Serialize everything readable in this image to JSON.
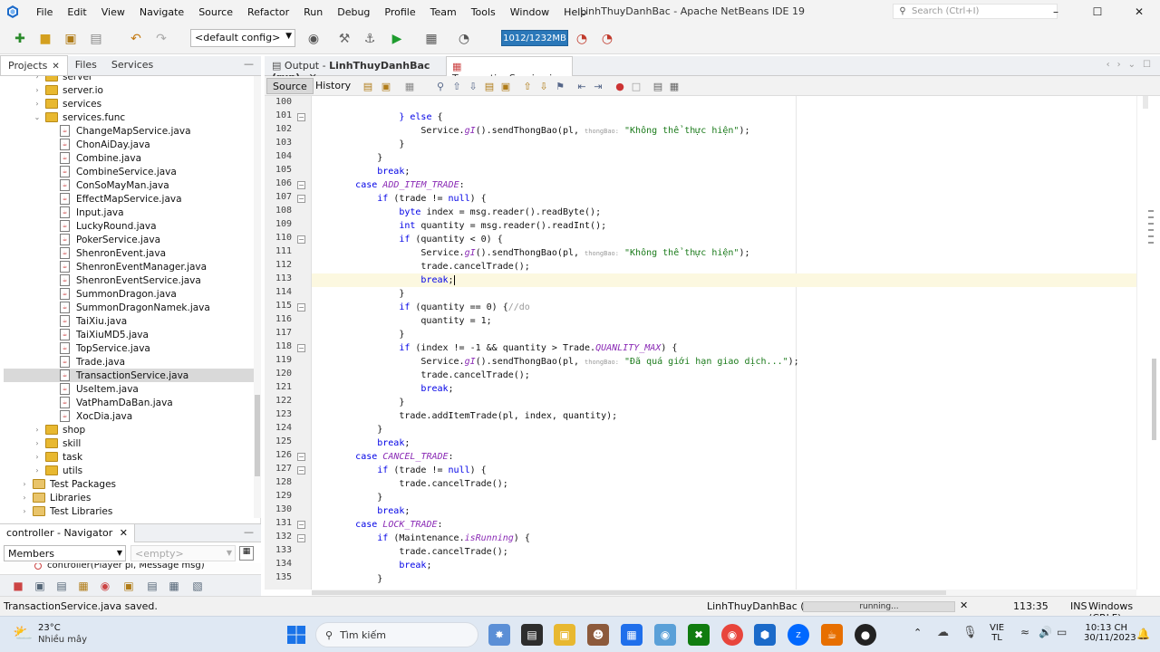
{
  "window": {
    "title": "LinhThuyDanhBac - Apache NetBeans IDE 19",
    "search_placeholder": "Search (Ctrl+I)",
    "minimize": "–",
    "maximize": "☐",
    "close": "✕"
  },
  "menu": [
    "File",
    "Edit",
    "View",
    "Navigate",
    "Source",
    "Refactor",
    "Run",
    "Debug",
    "Profile",
    "Team",
    "Tools",
    "Window",
    "Help"
  ],
  "toolbar": {
    "config": "<default config>",
    "memory": "1012/1232MB"
  },
  "left_tabs": [
    "Projects",
    "Files",
    "Services"
  ],
  "tree": [
    {
      "label": "server",
      "type": "folder"
    },
    {
      "label": "server.io",
      "type": "folder"
    },
    {
      "label": "services",
      "type": "folder"
    },
    {
      "label": "services.func",
      "type": "folder",
      "open": true
    },
    {
      "label": "ChangeMapService.java",
      "type": "file"
    },
    {
      "label": "ChonAiDay.java",
      "type": "file"
    },
    {
      "label": "Combine.java",
      "type": "file"
    },
    {
      "label": "CombineService.java",
      "type": "file"
    },
    {
      "label": "ConSoMayMan.java",
      "type": "file"
    },
    {
      "label": "EffectMapService.java",
      "type": "file"
    },
    {
      "label": "Input.java",
      "type": "file"
    },
    {
      "label": "LuckyRound.java",
      "type": "file"
    },
    {
      "label": "PokerService.java",
      "type": "file"
    },
    {
      "label": "ShenronEvent.java",
      "type": "file"
    },
    {
      "label": "ShenronEventManager.java",
      "type": "file"
    },
    {
      "label": "ShenronEventService.java",
      "type": "file"
    },
    {
      "label": "SummonDragon.java",
      "type": "file"
    },
    {
      "label": "SummonDragonNamek.java",
      "type": "file"
    },
    {
      "label": "TaiXiu.java",
      "type": "file"
    },
    {
      "label": "TaiXiuMD5.java",
      "type": "file"
    },
    {
      "label": "TopService.java",
      "type": "file"
    },
    {
      "label": "Trade.java",
      "type": "file"
    },
    {
      "label": "TransactionService.java",
      "type": "file",
      "selected": true
    },
    {
      "label": "UseItem.java",
      "type": "file"
    },
    {
      "label": "VatPhamDaBan.java",
      "type": "file"
    },
    {
      "label": "XocDia.java",
      "type": "file"
    },
    {
      "label": "shop",
      "type": "folder"
    },
    {
      "label": "skill",
      "type": "folder"
    },
    {
      "label": "task",
      "type": "folder"
    },
    {
      "label": "utils",
      "type": "folder"
    },
    {
      "label": "Test Packages",
      "type": "pkg"
    },
    {
      "label": "Libraries",
      "type": "pkg"
    },
    {
      "label": "Test Libraries",
      "type": "pkg"
    }
  ],
  "navigator": {
    "title": "controller - Navigator",
    "members": "Members",
    "filter": "<empty>",
    "item": "controller(Player pl, Message msg)"
  },
  "editor_tabs": {
    "output_prefix": "Output - ",
    "output_name": "LinhThuyDanhBac (run)",
    "file": "TransactionService.java"
  },
  "editor_toolbar": {
    "source": "Source",
    "history": "History"
  },
  "code_lines": [
    {
      "n": "100",
      "html": ""
    },
    {
      "n": "101",
      "html": "                <span class=\"kw\">}</span> <span class=\"kw\">else</span> {"
    },
    {
      "n": "102",
      "html": "                    Service.<span class=\"it\">gI</span>().sendThongBao(pl, <span class=\"hint\">thongBao:</span> <span class=\"str\">\"Không thể thực hiện\"</span>);"
    },
    {
      "n": "103",
      "html": "                }"
    },
    {
      "n": "104",
      "html": "            }"
    },
    {
      "n": "105",
      "html": "            <span class=\"kw\">break</span>;"
    },
    {
      "n": "106",
      "html": "        <span class=\"kw\">case</span> <span class=\"it\">ADD_ITEM_TRADE</span>:"
    },
    {
      "n": "107",
      "html": "            <span class=\"kw\">if</span> (trade != <span class=\"kw\">null</span>) {"
    },
    {
      "n": "108",
      "html": "                <span class=\"kw\">byte</span> index = msg.reader().readByte();"
    },
    {
      "n": "109",
      "html": "                <span class=\"kw\">int</span> quantity = msg.reader().readInt();"
    },
    {
      "n": "110",
      "html": "                <span class=\"kw\">if</span> (quantity &lt; 0) {"
    },
    {
      "n": "111",
      "html": "                    Service.<span class=\"it\">gI</span>().sendThongBao(pl, <span class=\"hint\">thongBao:</span> <span class=\"str\">\"Không thể thực hiện\"</span>);"
    },
    {
      "n": "112",
      "html": "                    trade.cancelTrade();"
    },
    {
      "n": "113",
      "html": "                    <span class=\"kw\">break</span>;",
      "hl": true
    },
    {
      "n": "114",
      "html": "                }"
    },
    {
      "n": "115",
      "html": "                <span class=\"kw\">if</span> (quantity == 0) {<span class=\"cm\">//do</span>"
    },
    {
      "n": "116",
      "html": "                    quantity = 1;"
    },
    {
      "n": "117",
      "html": "                }"
    },
    {
      "n": "118",
      "html": "                <span class=\"kw\">if</span> (index != -1 &amp;&amp; quantity &gt; Trade.<span class=\"it\">QUANLITY_MAX</span>) {"
    },
    {
      "n": "119",
      "html": "                    Service.<span class=\"it\">gI</span>().sendThongBao(pl, <span class=\"hint\">thongBao:</span> <span class=\"str\">\"Đã quá giới hạn giao dịch...\"</span>);"
    },
    {
      "n": "120",
      "html": "                    trade.cancelTrade();"
    },
    {
      "n": "121",
      "html": "                    <span class=\"kw\">break</span>;"
    },
    {
      "n": "122",
      "html": "                }"
    },
    {
      "n": "123",
      "html": "                trade.addItemTrade(pl, index, quantity);"
    },
    {
      "n": "124",
      "html": "            }"
    },
    {
      "n": "125",
      "html": "            <span class=\"kw\">break</span>;"
    },
    {
      "n": "126",
      "html": "        <span class=\"kw\">case</span> <span class=\"it\">CANCEL_TRADE</span>:"
    },
    {
      "n": "127",
      "html": "            <span class=\"kw\">if</span> (trade != <span class=\"kw\">null</span>) {"
    },
    {
      "n": "128",
      "html": "                trade.cancelTrade();"
    },
    {
      "n": "129",
      "html": "            }"
    },
    {
      "n": "130",
      "html": "            <span class=\"kw\">break</span>;"
    },
    {
      "n": "131",
      "html": "        <span class=\"kw\">case</span> <span class=\"it\">LOCK_TRADE</span>:"
    },
    {
      "n": "132",
      "html": "            <span class=\"kw\">if</span> (Maintenance.<span class=\"it\">isRunning</span>) {"
    },
    {
      "n": "133",
      "html": "                trade.cancelTrade();"
    },
    {
      "n": "134",
      "html": "                <span class=\"kw\">break</span>;"
    },
    {
      "n": "135",
      "html": "            }"
    }
  ],
  "status": {
    "message": "TransactionService.java saved.",
    "project": "LinhThuyDanhBac (run)",
    "running": "running...",
    "position": "113:35",
    "mode": "INS",
    "eol": "Windows (CRLF)"
  },
  "taskbar": {
    "temp": "23°C",
    "weather": "Nhiều mây",
    "search": "Tìm kiếm",
    "lang1": "VIE",
    "lang2": "TL",
    "time": "10:13 CH",
    "date": "30/11/2023"
  }
}
